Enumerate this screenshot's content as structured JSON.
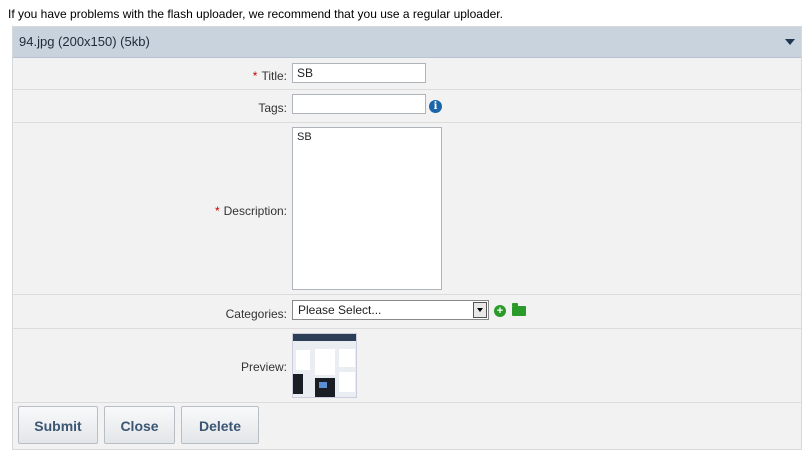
{
  "notice": "If you have problems with the flash uploader, we recommend that you use a regular uploader.",
  "panel": {
    "title": "94.jpg (200x150) (5kb)"
  },
  "form": {
    "title_label": "Title:",
    "title_value": "SB",
    "tags_label": "Tags:",
    "tags_value": "",
    "description_label": "Description:",
    "description_value": "SB",
    "categories_label": "Categories:",
    "categories_selected": "Please Select...",
    "preview_label": "Preview:",
    "required_mark": "*"
  },
  "buttons": {
    "submit": "Submit",
    "close": "Close",
    "delete": "Delete"
  },
  "icons": {
    "tags_info": "info-icon",
    "categories_add": "add-icon",
    "categories_folder": "folder-icon",
    "panel_collapse": "chevron-down-icon"
  }
}
